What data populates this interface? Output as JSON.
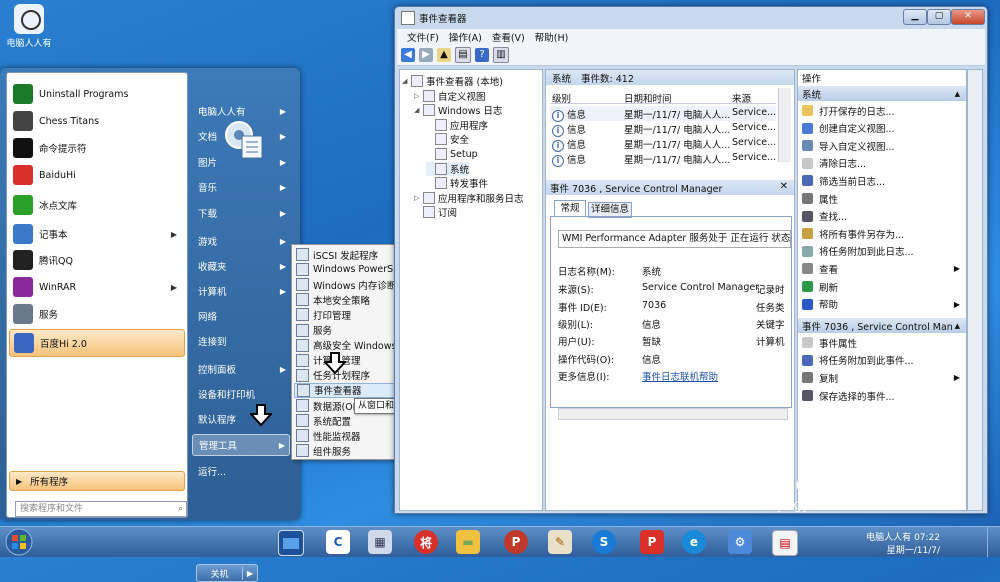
{
  "desktop": {
    "icon_label": "电脑人人有"
  },
  "start_menu": {
    "left_items": [
      {
        "label": "Uninstall Programs",
        "icon": "uninstall-icon",
        "color": "#1a7a2a"
      },
      {
        "label": "Chess Titans",
        "icon": "chess-icon",
        "color": "#444444"
      },
      {
        "label": "命令提示符",
        "icon": "cmd-icon",
        "color": "#111111"
      },
      {
        "label": "BaiduHi",
        "icon": "baiduhi-icon",
        "color": "#d9302a"
      },
      {
        "label": "冰点文库",
        "icon": "bingdian-icon",
        "color": "#2aa02a"
      },
      {
        "label": "记事本",
        "icon": "notepad-icon",
        "color": "#3a78c8"
      },
      {
        "label": "腾讯QQ",
        "icon": "qq-icon",
        "color": "#222222"
      },
      {
        "label": "WinRAR",
        "icon": "winrar-icon",
        "color": "#8a2a9a"
      },
      {
        "label": "服务",
        "icon": "services-icon",
        "color": "#6a7a8a"
      },
      {
        "label": "百度Hi 2.0",
        "icon": "baiduhi2-icon",
        "color": "#3a68c0"
      }
    ],
    "all_programs": "所有程序",
    "search_placeholder": "搜索程序和文件",
    "right_items": [
      {
        "label": "电脑人人有"
      },
      {
        "label": "文档"
      },
      {
        "label": "图片"
      },
      {
        "label": "音乐"
      },
      {
        "label": "下载"
      },
      {
        "label": "游戏"
      },
      {
        "label": "收藏夹"
      },
      {
        "label": "计算机"
      },
      {
        "label": "网络"
      },
      {
        "label": "连接到"
      },
      {
        "label": "控制面板"
      },
      {
        "label": "设备和打印机"
      },
      {
        "label": "默认程序"
      },
      {
        "label": "管理工具"
      },
      {
        "label": "运行..."
      }
    ],
    "shutdown": "关机"
  },
  "submenu": {
    "items": [
      "iSCSI 发起程序",
      "Windows PowerShell Modules",
      "Windows 内存诊断",
      "本地安全策略",
      "打印管理",
      "服务",
      "高级安全 Windows 防火墙",
      "计算机管理",
      "任务计划程序",
      "事件查看器",
      "数据源(ODBC)",
      "系统配置",
      "性能监视器",
      "组件服务"
    ],
    "tooltip": "从窗口和其他程序中查看监视和疑难解答消息。"
  },
  "event_viewer": {
    "title": "事件查看器",
    "menu": [
      "文件(F)",
      "操作(A)",
      "查看(V)",
      "帮助(H)"
    ],
    "tree": [
      {
        "label": "事件查看器 (本地)",
        "level": 0
      },
      {
        "label": "自定义视图",
        "level": 1
      },
      {
        "label": "Windows 日志",
        "level": 1
      },
      {
        "label": "应用程序",
        "level": 2
      },
      {
        "label": "安全",
        "level": 2
      },
      {
        "label": "Setup",
        "level": 2
      },
      {
        "label": "系统",
        "level": 2
      },
      {
        "label": "转发事件",
        "level": 2
      },
      {
        "label": "应用程序和服务日志",
        "level": 1
      },
      {
        "label": "订阅",
        "level": 1
      }
    ],
    "list_header": {
      "name": "系统",
      "count": "事件数: 412"
    },
    "list_columns": [
      "级别",
      "日期和时间",
      "来源"
    ],
    "list_rows": [
      {
        "level": "信息",
        "date": "星期一/11/7/ 电脑人人...",
        "source": "Service..."
      },
      {
        "level": "信息",
        "date": "星期一/11/7/ 电脑人人...",
        "source": "Service..."
      },
      {
        "level": "信息",
        "date": "星期一/11/7/ 电脑人人...",
        "source": "Service..."
      },
      {
        "level": "信息",
        "date": "星期一/11/7/ 电脑人人...",
        "source": "Service..."
      }
    ],
    "detail_title": "事件 7036 , Service Control Manager",
    "tabs": [
      "常规",
      "详细信息"
    ],
    "description": "WMI Performance Adapter 服务处于 正在运行 状态。",
    "fields": [
      {
        "key": "日志名称(M):",
        "value": "系统",
        "extra": ""
      },
      {
        "key": "来源(S):",
        "value": "Service Control Manager",
        "extra": "记录时"
      },
      {
        "key": "事件 ID(E):",
        "value": "7036",
        "extra": "任务类"
      },
      {
        "key": "级别(L):",
        "value": "信息",
        "extra": "关键字"
      },
      {
        "key": "用户(U):",
        "value": "暂缺",
        "extra": "计算机"
      },
      {
        "key": "操作代码(O):",
        "value": "信息",
        "extra": ""
      },
      {
        "key": "更多信息(I):",
        "value": "事件日志联机帮助",
        "extra": ""
      }
    ],
    "actions_title": "操作",
    "action_sections": [
      {
        "title": "系统",
        "items": [
          {
            "label": "打开保存的日志...",
            "arrow": false
          },
          {
            "label": "创建自定义视图...",
            "arrow": false
          },
          {
            "label": "导入自定义视图...",
            "arrow": false
          },
          {
            "label": "清除日志...",
            "arrow": false
          },
          {
            "label": "筛选当前日志...",
            "arrow": false
          },
          {
            "label": "属性",
            "arrow": false
          },
          {
            "label": "查找...",
            "arrow": false
          },
          {
            "label": "将所有事件另存为...",
            "arrow": false
          },
          {
            "label": "将任务附加到此日志...",
            "arrow": false
          },
          {
            "label": "查看",
            "arrow": true
          },
          {
            "label": "刷新",
            "arrow": false
          },
          {
            "label": "帮助",
            "arrow": true
          }
        ]
      },
      {
        "title": "事件 7036 , Service Control Man...",
        "items": [
          {
            "label": "事件属性",
            "arrow": false
          },
          {
            "label": "将任务附加到此事件...",
            "arrow": false
          },
          {
            "label": "复制",
            "arrow": true
          },
          {
            "label": "保存选择的事件...",
            "arrow": false
          }
        ]
      }
    ]
  },
  "watermark": {
    "brand": "Bai du 经验",
    "url": "jingyan.baidu.com"
  },
  "taskbar": {
    "user": "电脑人人有",
    "time": "07:22",
    "date": "星期一/11/7/"
  },
  "colors": {
    "accent": "#3d7ab8",
    "highlight": "#f7c37a",
    "link": "#1a4fb0"
  }
}
